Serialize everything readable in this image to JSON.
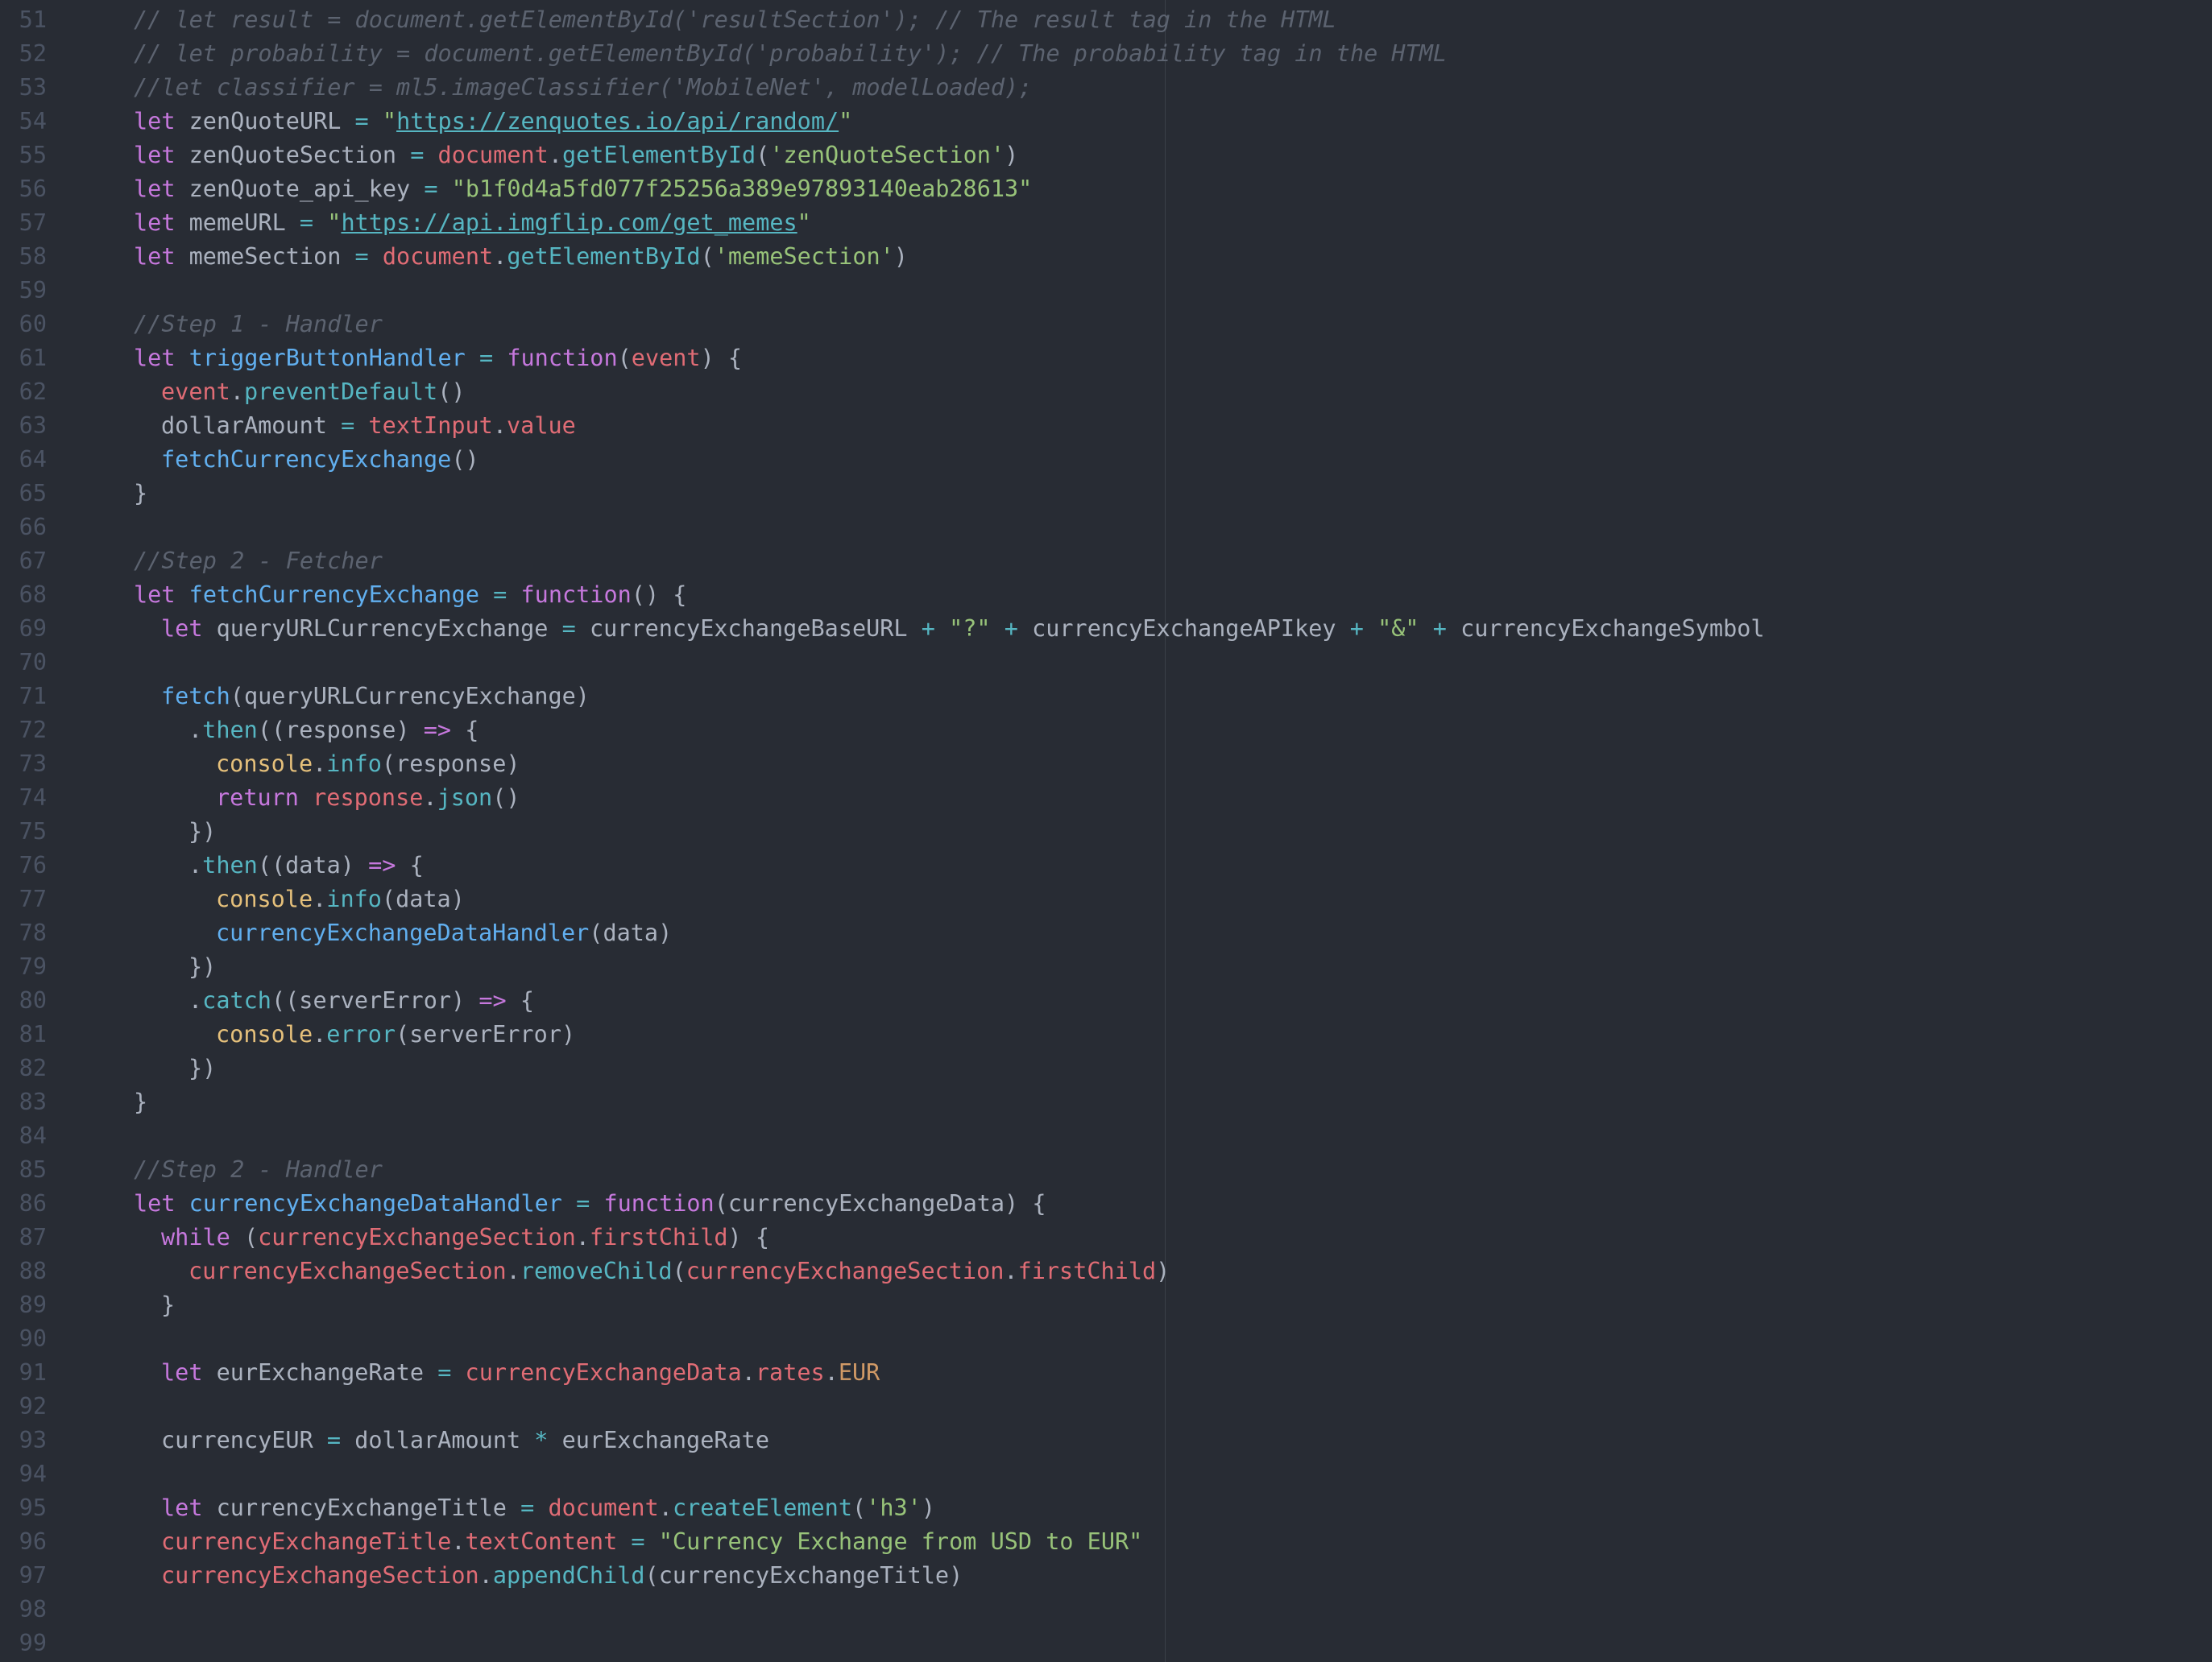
{
  "editor": {
    "lines": [
      {
        "n": "51",
        "i": 0,
        "t": [
          [
            "cm",
            "// let result = document.getElementById('resultSection'); // The result tag in the HTML"
          ]
        ]
      },
      {
        "n": "52",
        "i": 0,
        "t": [
          [
            "cm",
            "// let probability = document.getElementById('probability'); // The probability tag in the HTML"
          ]
        ]
      },
      {
        "n": "53",
        "i": 0,
        "t": [
          [
            "cm",
            "//let classifier = ml5.imageClassifier('MobileNet', modelLoaded);"
          ]
        ]
      },
      {
        "n": "54",
        "i": 0,
        "t": [
          [
            "kw",
            "let"
          ],
          [
            "",
            " zenQuoteURL "
          ],
          [
            "op",
            "="
          ],
          [
            "",
            " "
          ],
          [
            "str",
            "\""
          ],
          [
            "url",
            "https://zenquotes.io/api/random/"
          ],
          [
            "str",
            "\""
          ]
        ]
      },
      {
        "n": "55",
        "i": 0,
        "t": [
          [
            "kw",
            "let"
          ],
          [
            "",
            " zenQuoteSection "
          ],
          [
            "op",
            "="
          ],
          [
            "",
            " "
          ],
          [
            "rd",
            "document"
          ],
          [
            "",
            "."
          ],
          [
            "mt",
            "getElementById"
          ],
          [
            "",
            "("
          ],
          [
            "str",
            "'zenQuoteSection'"
          ],
          [
            "",
            ")"
          ]
        ]
      },
      {
        "n": "56",
        "i": 0,
        "t": [
          [
            "kw",
            "let"
          ],
          [
            "",
            " zenQuote_api_key "
          ],
          [
            "op",
            "="
          ],
          [
            "",
            " "
          ],
          [
            "str",
            "\"b1f0d4a5fd077f25256a389e97893140eab28613\""
          ]
        ]
      },
      {
        "n": "57",
        "i": 0,
        "t": [
          [
            "kw",
            "let"
          ],
          [
            "",
            " memeURL "
          ],
          [
            "op",
            "="
          ],
          [
            "",
            " "
          ],
          [
            "str",
            "\""
          ],
          [
            "url",
            "https://api.imgflip.com/get_memes"
          ],
          [
            "str",
            "\""
          ]
        ]
      },
      {
        "n": "58",
        "i": 0,
        "t": [
          [
            "kw",
            "let"
          ],
          [
            "",
            " memeSection "
          ],
          [
            "op",
            "="
          ],
          [
            "",
            " "
          ],
          [
            "rd",
            "document"
          ],
          [
            "",
            "."
          ],
          [
            "mt",
            "getElementById"
          ],
          [
            "",
            "("
          ],
          [
            "str",
            "'memeSection'"
          ],
          [
            "",
            ")"
          ]
        ]
      },
      {
        "n": "59",
        "i": 0,
        "t": []
      },
      {
        "n": "60",
        "i": 0,
        "t": [
          [
            "cm",
            "//Step 1 - Handler"
          ]
        ]
      },
      {
        "n": "61",
        "i": 0,
        "t": [
          [
            "kw",
            "let"
          ],
          [
            "",
            " "
          ],
          [
            "fn",
            "triggerButtonHandler"
          ],
          [
            "",
            " "
          ],
          [
            "op",
            "="
          ],
          [
            "",
            " "
          ],
          [
            "kw",
            "function"
          ],
          [
            "",
            "("
          ],
          [
            "rd",
            "event"
          ],
          [
            "",
            ") {"
          ]
        ]
      },
      {
        "n": "62",
        "i": 1,
        "t": [
          [
            "rd",
            "event"
          ],
          [
            "",
            "."
          ],
          [
            "mt",
            "preventDefault"
          ],
          [
            "",
            "()"
          ]
        ]
      },
      {
        "n": "63",
        "i": 1,
        "t": [
          [
            "",
            "dollarAmount "
          ],
          [
            "op",
            "="
          ],
          [
            "",
            " "
          ],
          [
            "rd",
            "textInput"
          ],
          [
            "",
            "."
          ],
          [
            "rd",
            "value"
          ]
        ]
      },
      {
        "n": "64",
        "i": 1,
        "t": [
          [
            "fn",
            "fetchCurrencyExchange"
          ],
          [
            "",
            "()"
          ]
        ]
      },
      {
        "n": "65",
        "i": 0,
        "t": [
          [
            "",
            "}"
          ]
        ]
      },
      {
        "n": "66",
        "i": 0,
        "t": []
      },
      {
        "n": "67",
        "i": 0,
        "t": [
          [
            "cm",
            "//Step 2 - Fetcher"
          ]
        ]
      },
      {
        "n": "68",
        "i": 0,
        "t": [
          [
            "kw",
            "let"
          ],
          [
            "",
            " "
          ],
          [
            "fn",
            "fetchCurrencyExchange"
          ],
          [
            "",
            " "
          ],
          [
            "op",
            "="
          ],
          [
            "",
            " "
          ],
          [
            "kw",
            "function"
          ],
          [
            "",
            "() {"
          ]
        ]
      },
      {
        "n": "69",
        "i": 1,
        "t": [
          [
            "kw",
            "let"
          ],
          [
            "",
            " queryURLCurrencyExchange "
          ],
          [
            "op",
            "="
          ],
          [
            "",
            " currencyExchangeBaseURL "
          ],
          [
            "op",
            "+"
          ],
          [
            "",
            " "
          ],
          [
            "str",
            "\"?\""
          ],
          [
            "",
            " "
          ],
          [
            "op",
            "+"
          ],
          [
            "",
            " currencyExchangeAPIkey "
          ],
          [
            "op",
            "+"
          ],
          [
            "",
            " "
          ],
          [
            "str",
            "\"&\""
          ],
          [
            "",
            " "
          ],
          [
            "op",
            "+"
          ],
          [
            "",
            " currencyExchangeSymbol"
          ]
        ]
      },
      {
        "n": "70",
        "i": 0,
        "t": []
      },
      {
        "n": "71",
        "i": 1,
        "t": [
          [
            "fn",
            "fetch"
          ],
          [
            "",
            "(queryURLCurrencyExchange)"
          ]
        ]
      },
      {
        "n": "72",
        "i": 2,
        "t": [
          [
            "",
            "."
          ],
          [
            "mt",
            "then"
          ],
          [
            "",
            "((response) "
          ],
          [
            "kw",
            "=>"
          ],
          [
            "",
            " {"
          ]
        ]
      },
      {
        "n": "73",
        "i": 3,
        "t": [
          [
            "cn",
            "console"
          ],
          [
            "",
            "."
          ],
          [
            "mt",
            "info"
          ],
          [
            "",
            "(response)"
          ]
        ]
      },
      {
        "n": "74",
        "i": 3,
        "t": [
          [
            "kw",
            "return"
          ],
          [
            "",
            " "
          ],
          [
            "rd",
            "response"
          ],
          [
            "",
            "."
          ],
          [
            "mt",
            "json"
          ],
          [
            "",
            "()"
          ]
        ]
      },
      {
        "n": "75",
        "i": 2,
        "t": [
          [
            "",
            "})"
          ]
        ]
      },
      {
        "n": "76",
        "i": 2,
        "t": [
          [
            "",
            "."
          ],
          [
            "mt",
            "then"
          ],
          [
            "",
            "((data) "
          ],
          [
            "kw",
            "=>"
          ],
          [
            "",
            " {"
          ]
        ]
      },
      {
        "n": "77",
        "i": 3,
        "t": [
          [
            "cn",
            "console"
          ],
          [
            "",
            "."
          ],
          [
            "mt",
            "info"
          ],
          [
            "",
            "(data)"
          ]
        ]
      },
      {
        "n": "78",
        "i": 3,
        "t": [
          [
            "fn",
            "currencyExchangeDataHandler"
          ],
          [
            "",
            "(data)"
          ]
        ]
      },
      {
        "n": "79",
        "i": 2,
        "t": [
          [
            "",
            "})"
          ]
        ]
      },
      {
        "n": "80",
        "i": 2,
        "t": [
          [
            "",
            "."
          ],
          [
            "mt",
            "catch"
          ],
          [
            "",
            "((serverError) "
          ],
          [
            "kw",
            "=>"
          ],
          [
            "",
            " {"
          ]
        ]
      },
      {
        "n": "81",
        "i": 3,
        "t": [
          [
            "cn",
            "console"
          ],
          [
            "",
            "."
          ],
          [
            "mt",
            "error"
          ],
          [
            "",
            "(serverError)"
          ]
        ]
      },
      {
        "n": "82",
        "i": 2,
        "t": [
          [
            "",
            "})"
          ]
        ]
      },
      {
        "n": "83",
        "i": 0,
        "t": [
          [
            "",
            "}"
          ]
        ]
      },
      {
        "n": "84",
        "i": 0,
        "t": []
      },
      {
        "n": "85",
        "i": 0,
        "t": [
          [
            "cm",
            "//Step 2 - Handler"
          ]
        ]
      },
      {
        "n": "86",
        "i": 0,
        "t": [
          [
            "kw",
            "let"
          ],
          [
            "",
            " "
          ],
          [
            "fn",
            "currencyExchangeDataHandler"
          ],
          [
            "",
            " "
          ],
          [
            "op",
            "="
          ],
          [
            "",
            " "
          ],
          [
            "kw",
            "function"
          ],
          [
            "",
            "(currencyExchangeData) {"
          ]
        ]
      },
      {
        "n": "87",
        "i": 1,
        "t": [
          [
            "kw",
            "while"
          ],
          [
            "",
            " ("
          ],
          [
            "rd",
            "currencyExchangeSection"
          ],
          [
            "",
            "."
          ],
          [
            "rd",
            "firstChild"
          ],
          [
            "",
            ") {"
          ]
        ]
      },
      {
        "n": "88",
        "i": 2,
        "t": [
          [
            "rd",
            "currencyExchangeSection"
          ],
          [
            "",
            "."
          ],
          [
            "mt",
            "removeChild"
          ],
          [
            "",
            "("
          ],
          [
            "rd",
            "currencyExchangeSection"
          ],
          [
            "",
            "."
          ],
          [
            "rd",
            "firstChild"
          ],
          [
            "",
            ")"
          ]
        ]
      },
      {
        "n": "89",
        "i": 1,
        "t": [
          [
            "",
            "}"
          ]
        ]
      },
      {
        "n": "90",
        "i": 0,
        "t": []
      },
      {
        "n": "91",
        "i": 1,
        "t": [
          [
            "kw",
            "let"
          ],
          [
            "",
            " eurExchangeRate "
          ],
          [
            "op",
            "="
          ],
          [
            "",
            " "
          ],
          [
            "rd",
            "currencyExchangeData"
          ],
          [
            "",
            "."
          ],
          [
            "rd",
            "rates"
          ],
          [
            "",
            "."
          ],
          [
            "num",
            "EUR"
          ]
        ]
      },
      {
        "n": "92",
        "i": 0,
        "t": []
      },
      {
        "n": "93",
        "i": 1,
        "t": [
          [
            "",
            "currencyEUR "
          ],
          [
            "op",
            "="
          ],
          [
            "",
            " dollarAmount "
          ],
          [
            "op",
            "*"
          ],
          [
            "",
            " eurExchangeRate"
          ]
        ]
      },
      {
        "n": "94",
        "i": 0,
        "t": []
      },
      {
        "n": "95",
        "i": 1,
        "t": [
          [
            "kw",
            "let"
          ],
          [
            "",
            " currencyExchangeTitle "
          ],
          [
            "op",
            "="
          ],
          [
            "",
            " "
          ],
          [
            "rd",
            "document"
          ],
          [
            "",
            "."
          ],
          [
            "mt",
            "createElement"
          ],
          [
            "",
            "("
          ],
          [
            "str",
            "'h3'"
          ],
          [
            "",
            ")"
          ]
        ]
      },
      {
        "n": "96",
        "i": 1,
        "t": [
          [
            "rd",
            "currencyExchangeTitle"
          ],
          [
            "",
            "."
          ],
          [
            "rd",
            "textContent"
          ],
          [
            "",
            " "
          ],
          [
            "op",
            "="
          ],
          [
            "",
            " "
          ],
          [
            "str",
            "\"Currency Exchange from USD to EUR\""
          ]
        ]
      },
      {
        "n": "97",
        "i": 1,
        "t": [
          [
            "rd",
            "currencyExchangeSection"
          ],
          [
            "",
            "."
          ],
          [
            "mt",
            "appendChild"
          ],
          [
            "",
            "(currencyExchangeTitle)"
          ]
        ]
      },
      {
        "n": "98",
        "i": 0,
        "t": []
      },
      {
        "n": "99",
        "i": 0,
        "t": []
      }
    ]
  }
}
